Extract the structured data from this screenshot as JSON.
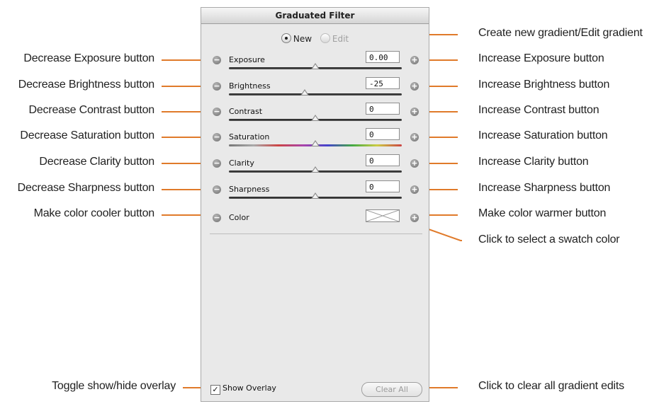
{
  "panel": {
    "title": "Graduated Filter",
    "mode": {
      "new_label": "New",
      "edit_label": "Edit",
      "selected": "New"
    },
    "adjustments": [
      {
        "id": "exposure",
        "label": "Exposure",
        "value": "0.00",
        "slider": 0.5,
        "track": "dark"
      },
      {
        "id": "brightness",
        "label": "Brightness",
        "value": "-25",
        "slider": 0.44,
        "track": "dark"
      },
      {
        "id": "contrast",
        "label": "Contrast",
        "value": "0",
        "slider": 0.5,
        "track": "dark"
      },
      {
        "id": "saturation",
        "label": "Saturation",
        "value": "0",
        "slider": 0.5,
        "track": "color"
      },
      {
        "id": "clarity",
        "label": "Clarity",
        "value": "0",
        "slider": 0.5,
        "track": "dark"
      },
      {
        "id": "sharpness",
        "label": "Sharpness",
        "value": "0",
        "slider": 0.5,
        "track": "dark"
      }
    ],
    "color_label": "Color",
    "minus_symbol": "−",
    "plus_symbol": "+",
    "show_overlay_label": "Show Overlay",
    "show_overlay_checked": true,
    "clear_all_label": "Clear All"
  },
  "callouts_left": [
    "Decrease Exposure button",
    "Decrease Brightness button",
    "Decrease Contrast button",
    "Decrease Saturation button",
    "Decrease Clarity button",
    "Decrease Sharpness button",
    "Make color cooler button",
    "Toggle show/hide overlay"
  ],
  "callouts_right": [
    "Create new gradient/Edit gradient",
    "Increase Exposure button",
    "Increase Brightness button",
    "Increase Contrast button",
    "Increase Saturation button",
    "Increase Clarity button",
    "Increase Sharpness button",
    "Make color warmer button",
    "Click to select a swatch color",
    "Click to clear all gradient edits"
  ],
  "colors": {
    "leader_line": "#e07a2a",
    "panel_bg": "#e9e9e9"
  }
}
